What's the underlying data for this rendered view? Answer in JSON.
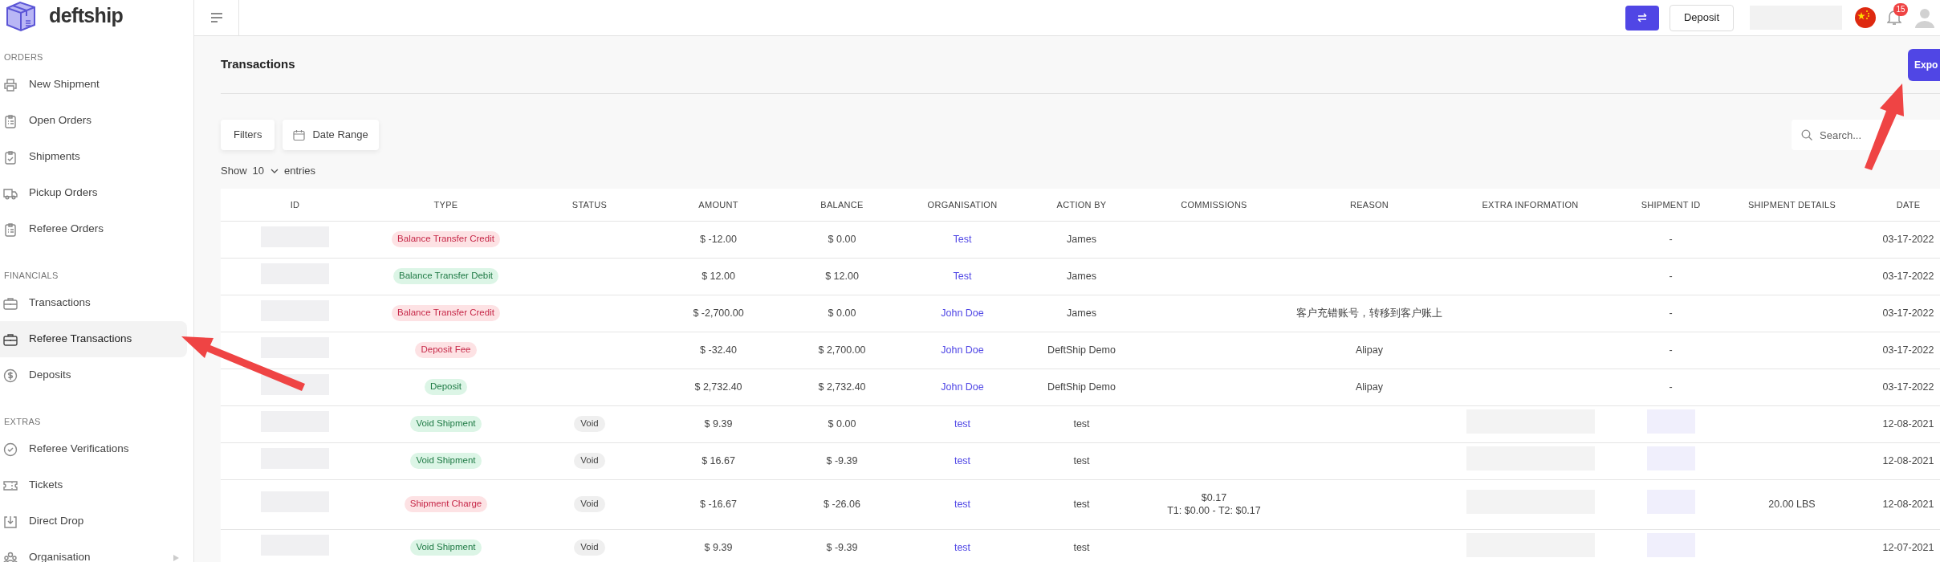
{
  "brand": {
    "name": "deftship"
  },
  "sidebar": {
    "sections": [
      {
        "title": "ORDERS",
        "items": [
          {
            "label": "New Shipment",
            "selected": false,
            "has_submenu": false
          },
          {
            "label": "Open Orders",
            "selected": false,
            "has_submenu": false
          },
          {
            "label": "Shipments",
            "selected": false,
            "has_submenu": false
          },
          {
            "label": "Pickup Orders",
            "selected": false,
            "has_submenu": false
          },
          {
            "label": "Referee Orders",
            "selected": false,
            "has_submenu": false
          }
        ]
      },
      {
        "title": "FINANCIALS",
        "items": [
          {
            "label": "Transactions",
            "selected": false,
            "has_submenu": false
          },
          {
            "label": "Referee Transactions",
            "selected": true,
            "has_submenu": false
          },
          {
            "label": "Deposits",
            "selected": false,
            "has_submenu": false
          }
        ]
      },
      {
        "title": "EXTRAS",
        "items": [
          {
            "label": "Referee Verifications",
            "selected": false,
            "has_submenu": false
          },
          {
            "label": "Tickets",
            "selected": false,
            "has_submenu": false
          },
          {
            "label": "Direct Drop",
            "selected": false,
            "has_submenu": false
          },
          {
            "label": "Organisation",
            "selected": false,
            "has_submenu": true
          }
        ]
      }
    ]
  },
  "header": {
    "deposit_button": "Deposit",
    "notification_count": "15"
  },
  "page": {
    "title": "Transactions",
    "export_button": "Expo"
  },
  "toolbar": {
    "filters_button": "Filters",
    "date_range_button": "Date Range",
    "search": {
      "placeholder": "Search..."
    }
  },
  "entries": {
    "show": "Show",
    "value": "10",
    "suffix": "entries"
  },
  "table": {
    "columns": [
      "ID",
      "TYPE",
      "STATUS",
      "AMOUNT",
      "BALANCE",
      "ORGANISATION",
      "ACTION BY",
      "COMMISSIONS",
      "REASON",
      "EXTRA INFORMATION",
      "SHIPMENT ID",
      "SHIPMENT DETAILS",
      "DATE"
    ],
    "rows": [
      {
        "type": {
          "label": "Balance Transfer Credit",
          "kind": "negative"
        },
        "amount": "$ -12.00",
        "balance": "$ 0.00",
        "organisation": "Test",
        "action_by": "James",
        "shipment_id": "-",
        "date": "03-17-2022"
      },
      {
        "type": {
          "label": "Balance Transfer Debit",
          "kind": "positive"
        },
        "amount": "$ 12.00",
        "balance": "$ 12.00",
        "organisation": "Test",
        "action_by": "James",
        "shipment_id": "-",
        "date": "03-17-2022"
      },
      {
        "type": {
          "label": "Balance Transfer Credit",
          "kind": "negative"
        },
        "amount": "$ -2,700.00",
        "balance": "$ 0.00",
        "organisation": "John Doe",
        "action_by": "James",
        "reason": "客户充错账号，转移到客户账上",
        "shipment_id": "-",
        "date": "03-17-2022"
      },
      {
        "type": {
          "label": "Deposit Fee",
          "kind": "negative"
        },
        "amount": "$ -32.40",
        "balance": "$ 2,700.00",
        "organisation": "John Doe",
        "action_by": "DeftShip Demo",
        "reason": "Alipay",
        "shipment_id": "-",
        "date": "03-17-2022"
      },
      {
        "type": {
          "label": "Deposit",
          "kind": "positive"
        },
        "amount": "$ 2,732.40",
        "balance": "$ 2,732.40",
        "organisation": "John Doe",
        "action_by": "DeftShip Demo",
        "reason": "Alipay",
        "shipment_id": "-",
        "date": "03-17-2022"
      },
      {
        "type": {
          "label": "Void Shipment",
          "kind": "positive"
        },
        "status": "Void",
        "amount": "$ 9.39",
        "balance": "$ 0.00",
        "organisation": "test",
        "action_by": "test",
        "redacted": true,
        "date": "12-08-2021"
      },
      {
        "type": {
          "label": "Void Shipment",
          "kind": "positive"
        },
        "status": "Void",
        "amount": "$ 16.67",
        "balance": "$ -9.39",
        "organisation": "test",
        "action_by": "test",
        "redacted": true,
        "date": "12-08-2021"
      },
      {
        "type": {
          "label": "Shipment Charge",
          "kind": "negative"
        },
        "status": "Void",
        "amount": "$ -16.67",
        "balance": "$ -26.06",
        "organisation": "test",
        "action_by": "test",
        "commissions": {
          "total": "$0.17",
          "breakdown": "T1: $0.00 - T2: $0.17"
        },
        "redacted": true,
        "shipment_details": "20.00 LBS",
        "date": "12-08-2021"
      },
      {
        "type": {
          "label": "Void Shipment",
          "kind": "positive"
        },
        "status": "Void",
        "amount": "$ 9.39",
        "balance": "$ -9.39",
        "organisation": "test",
        "action_by": "test",
        "redacted": true,
        "date": "12-07-2021"
      }
    ]
  }
}
